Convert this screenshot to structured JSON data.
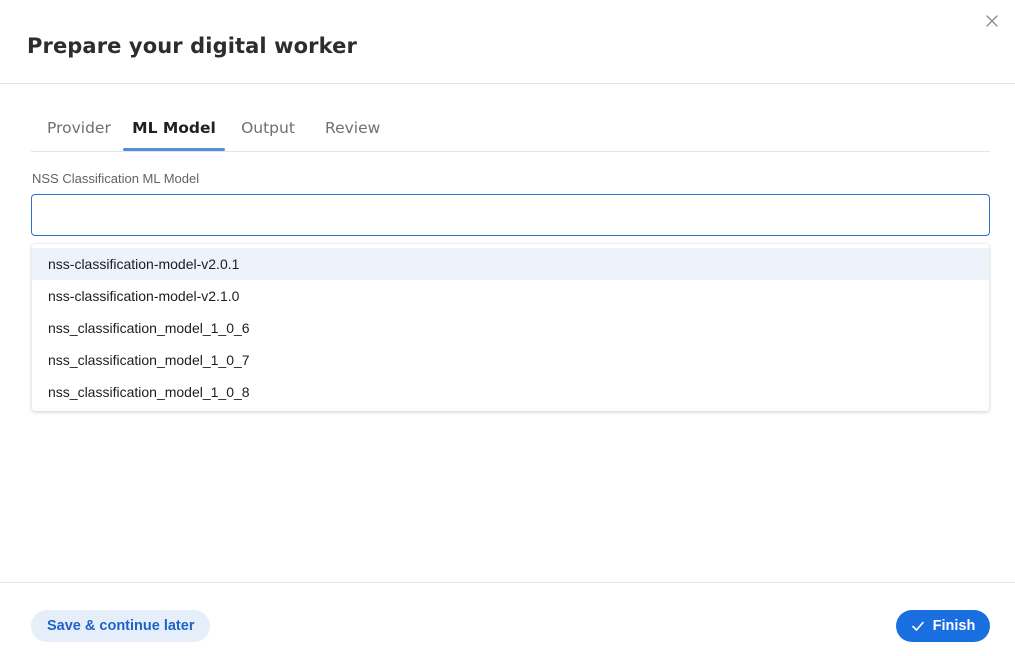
{
  "dialog": {
    "title": "Prepare your digital worker",
    "close_icon": "close-icon"
  },
  "tabs": [
    {
      "label": "Provider",
      "active": false
    },
    {
      "label": "ML Model",
      "active": true
    },
    {
      "label": "Output",
      "active": false
    },
    {
      "label": "Review",
      "active": false
    }
  ],
  "field": {
    "label": "NSS Classification ML Model",
    "value": "",
    "placeholder": ""
  },
  "dropdown": {
    "options": [
      "nss-classification-model-v2.0.1",
      "nss-classification-model-v2.1.0",
      "nss_classification_model_1_0_6",
      "nss_classification_model_1_0_7",
      "nss_classification_model_1_0_8"
    ],
    "highlighted_index": 0
  },
  "footer": {
    "save_later_label": "Save & continue later",
    "finish_label": "Finish",
    "finish_icon": "check-icon"
  },
  "colors": {
    "accent": "#1a6fe0",
    "tab_underline": "#4f8fdc",
    "secondary_button_bg": "#e6eef9",
    "option_highlight": "#eef3fb"
  }
}
